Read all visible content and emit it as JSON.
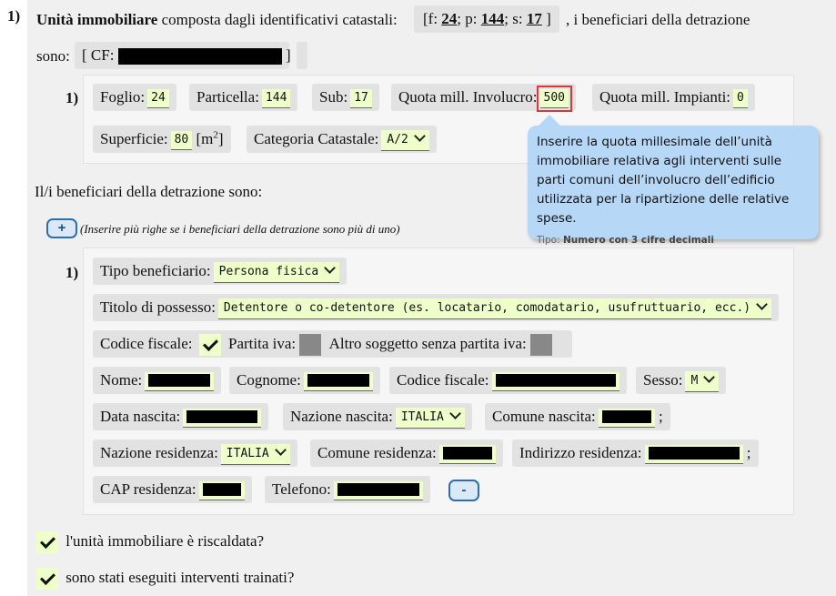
{
  "item_number": "1)",
  "header": {
    "title_bold": "Unità immobiliare",
    "title_rest": " composta dagli identificativi catastali:",
    "chip_prefix": "[f: ",
    "foglio": "24",
    "p_sep": "; p: ",
    "particella": "144",
    "s_sep": "; s: ",
    "sub": "17",
    "chip_suffix": " ]",
    "tail": ", i beneficiari della detrazione",
    "sono": "sono:",
    "cf_prefix": "[ CF:",
    "cf_suffix": "]"
  },
  "catasto": {
    "row_number": "1)",
    "foglio_label": "Foglio:",
    "foglio_value": "24",
    "particella_label": "Particella:",
    "particella_value": "144",
    "sub_label": "Sub:",
    "sub_value": "17",
    "quota_involucro_label": "Quota mill. Involucro:",
    "quota_involucro_value": "500",
    "quota_impianti_label": "Quota mill. Impianti:",
    "quota_impianti_value": "0",
    "superficie_label": "Superficie:",
    "superficie_value": "80",
    "superficie_unit": "[m",
    "superficie_exp": "2",
    "superficie_close": "]",
    "categoria_label": "Categoria Catastale:",
    "categoria_value": "A/2"
  },
  "tooltip": {
    "text": "Inserire la quota millesimale dell’unità immobiliare relativa agli interventi sulle parti comuni dell’involucro dell’edificio utilizzata per la ripartizione delle relative spese.",
    "type_label": "Tipo: ",
    "type_value": "Numero con 3 cifre decimali"
  },
  "beneficiari": {
    "heading": "Il/i beneficiari della detrazione sono:",
    "add_button": "+",
    "add_hint": "(Inserire più righe se i beneficiari della detrazione sono più di uno)",
    "row_number": "1)",
    "tipo_label": "Tipo beneficiario:",
    "tipo_value": "Persona fisica",
    "titolo_label": "Titolo di possesso:",
    "titolo_value": "Detentore o co-detentore (es. locatario, comodatario, usufruttuario, ecc.)",
    "codice_fiscale_label": "Codice fiscale:",
    "partita_iva_label": "Partita iva:",
    "altro_label": "Altro soggetto senza partita iva:",
    "nome_label": "Nome:",
    "cognome_label": "Cognome:",
    "cf_label": "Codice fiscale:",
    "sesso_label": "Sesso:",
    "sesso_value": "M",
    "data_nascita_label": "Data nascita:",
    "nazione_nascita_label": "Nazione nascita:",
    "nazione_nascita_value": "ITALIA",
    "comune_nascita_label": "Comune nascita:",
    "semicolon": ";",
    "nazione_res_label": "Nazione residenza:",
    "nazione_res_value": "ITALIA",
    "comune_res_label": "Comune residenza:",
    "indirizzo_res_label": "Indirizzo residenza:",
    "cap_label": "CAP residenza:",
    "telefono_label": "Telefono:",
    "remove_button": "-"
  },
  "questions": {
    "riscaldata": "l'unità immobiliare è riscaldata?",
    "trainati": "sono stati eseguiti interventi trainati?"
  },
  "colors": {
    "input_bg": "#efffc9",
    "chip_bg": "#e2e2e2",
    "tooltip_bg": "#b7d7f7",
    "button_border": "#2c6fb0",
    "focus_border": "#d9363e"
  }
}
